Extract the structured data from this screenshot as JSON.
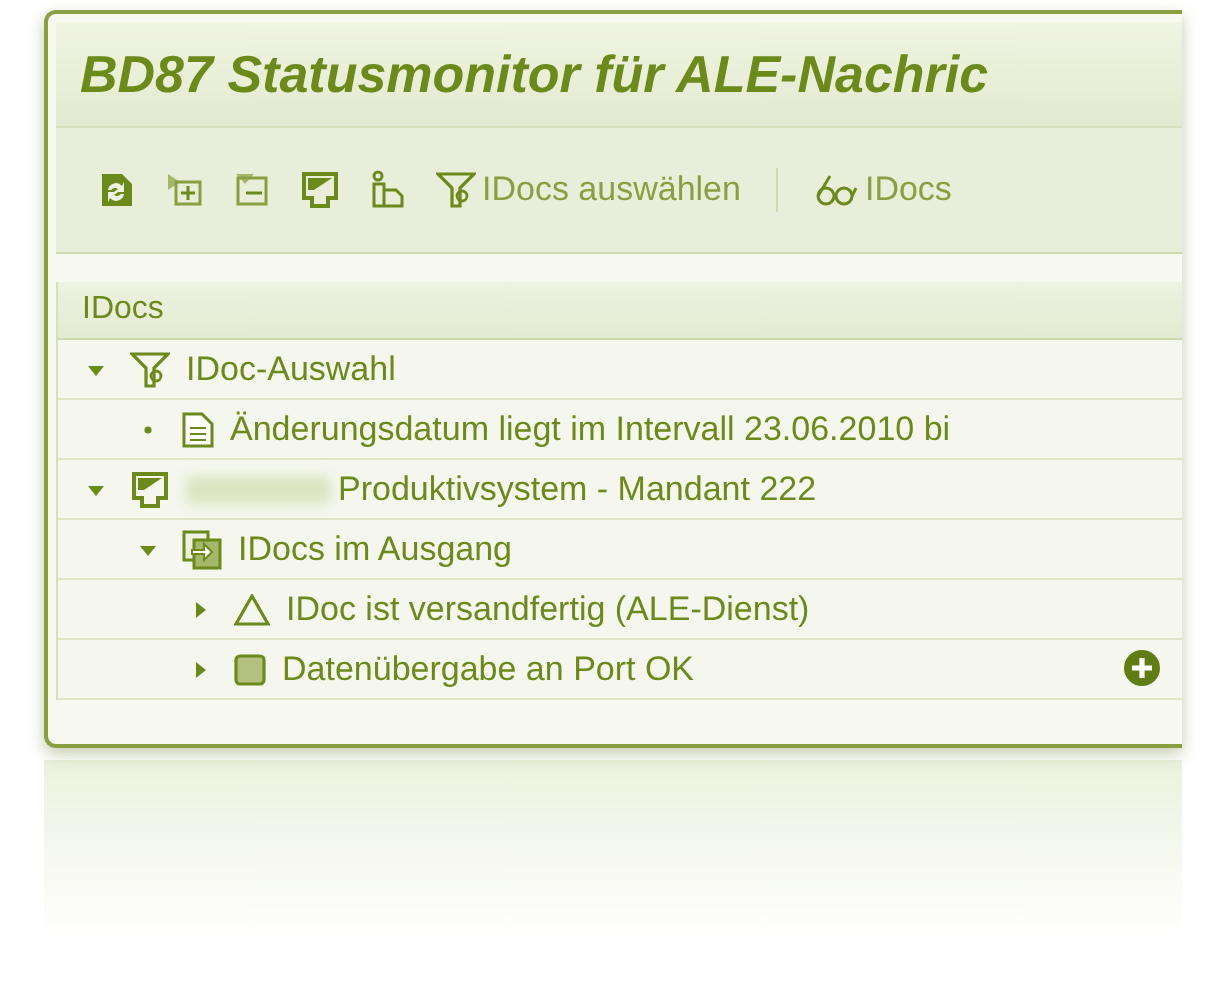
{
  "window": {
    "title": "BD87 Statusmonitor für ALE-Nachric"
  },
  "toolbar": {
    "buttons": [
      "IDocs auswählen",
      "IDocs"
    ]
  },
  "tree": {
    "header": "IDocs",
    "items": [
      {
        "kind": "filter",
        "label": "IDoc-Auswahl",
        "expanded": true,
        "children": [
          {
            "kind": "document",
            "label": "Änderungsdatum liegt im Intervall 23.06.2010 bi"
          }
        ]
      },
      {
        "kind": "system",
        "label": "Produktivsystem - Mandant 222",
        "redacted": true,
        "expanded": true,
        "children": [
          {
            "kind": "outbox",
            "label": "IDocs im Ausgang",
            "expanded": true,
            "children": [
              {
                "kind": "triangle",
                "label": "IDoc ist versandfertig (ALE-Dienst)",
                "expanded": false
              },
              {
                "kind": "square",
                "label": "Datenübergabe an Port OK",
                "expanded": false
              }
            ]
          }
        ]
      }
    ]
  }
}
